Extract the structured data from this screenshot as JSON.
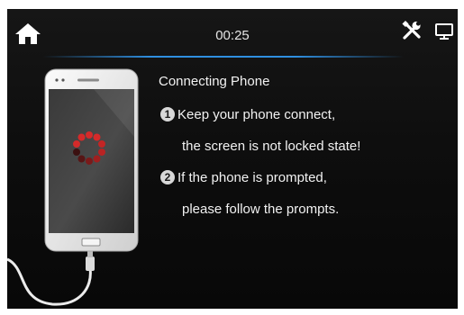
{
  "statusbar": {
    "time": "00:25",
    "icons": [
      "home-icon",
      "tools-icon",
      "display-icon"
    ]
  },
  "main": {
    "title": "Connecting Phone",
    "steps": [
      {
        "number": "1",
        "line1": "Keep your phone connect,",
        "line2": "the screen is not locked state!"
      },
      {
        "number": "2",
        "line1": "If the phone is prompted,",
        "line2": "please follow the prompts."
      }
    ]
  },
  "colors": {
    "background": "#0e0e0e",
    "divider": "#2f8fe0",
    "spinner": "#d42a2a",
    "text": "#f2f2f2"
  }
}
